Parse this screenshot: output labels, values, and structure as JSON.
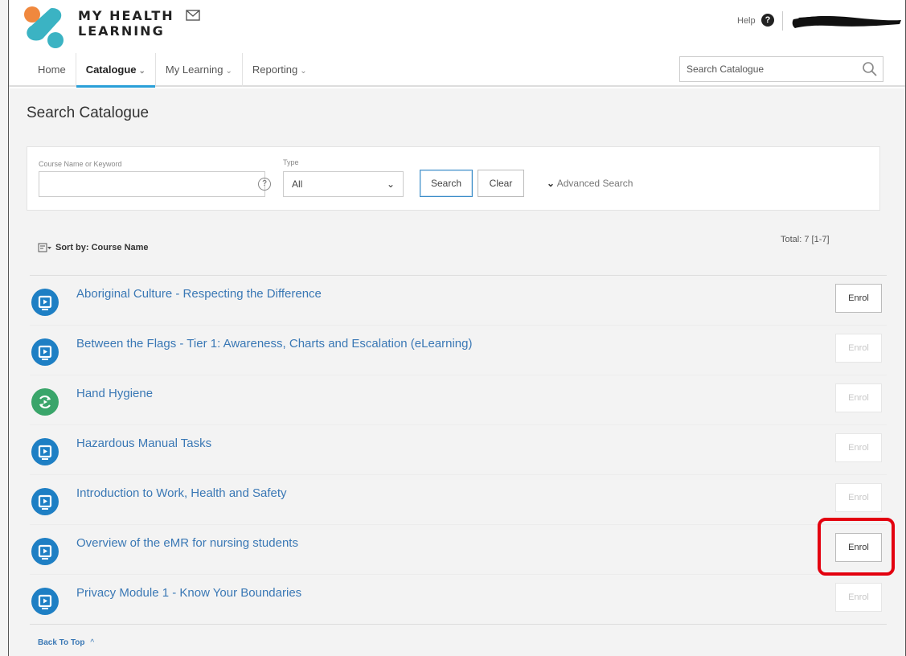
{
  "header": {
    "brand_line1": "MY HEALTH",
    "brand_line2": "LEARNING",
    "help_label": "Help",
    "help_glyph": "?",
    "logo_colors": {
      "orange": "#f0883e",
      "teal": "#3bb3c3"
    },
    "search_placeholder": "Search Catalogue"
  },
  "nav": {
    "items": [
      {
        "label": "Home",
        "has_menu": false,
        "active": false
      },
      {
        "label": "Catalogue",
        "has_menu": true,
        "active": true
      },
      {
        "label": "My Learning",
        "has_menu": true,
        "active": false
      },
      {
        "label": "Reporting",
        "has_menu": true,
        "active": false
      }
    ],
    "chevron": "⌄"
  },
  "page": {
    "title": "Search Catalogue"
  },
  "search_panel": {
    "keyword_label": "Course Name or Keyword",
    "keyword_value": "",
    "help_glyph": "?",
    "type_label": "Type",
    "type_value": "All",
    "type_chevron": "⌄",
    "search_button": "Search",
    "clear_button": "Clear",
    "advanced_label": "Advanced Search",
    "advanced_chevron": "⌄"
  },
  "results": {
    "sort_label": "Sort by: Course Name",
    "total": "Total: 7 [1-7]",
    "enrol_label": "Enrol",
    "courses": [
      {
        "name": "Aboriginal Culture - Respecting the Difference",
        "icon": "play-icon",
        "icon_color": "#1e7fc4",
        "enrol_enabled": true
      },
      {
        "name": "Between the Flags - Tier 1: Awareness, Charts and Escalation (eLearning)",
        "icon": "play-icon",
        "icon_color": "#1e7fc4",
        "enrol_enabled": false
      },
      {
        "name": "Hand Hygiene",
        "icon": "refresh-icon",
        "icon_color": "#3aa56a",
        "enrol_enabled": false
      },
      {
        "name": "Hazardous Manual Tasks",
        "icon": "play-icon",
        "icon_color": "#1e7fc4",
        "enrol_enabled": false
      },
      {
        "name": "Introduction to Work, Health and Safety",
        "icon": "play-icon",
        "icon_color": "#1e7fc4",
        "enrol_enabled": false
      },
      {
        "name": "Overview of the eMR for nursing students",
        "icon": "play-icon",
        "icon_color": "#1e7fc4",
        "enrol_enabled": true
      },
      {
        "name": "Privacy Module 1 - Know Your Boundaries",
        "icon": "play-icon",
        "icon_color": "#1e7fc4",
        "enrol_enabled": false
      }
    ]
  },
  "footer": {
    "back_to_top": "Back To Top",
    "back_to_top_glyph": "^"
  },
  "annotation": {
    "color": "#e3000f"
  }
}
